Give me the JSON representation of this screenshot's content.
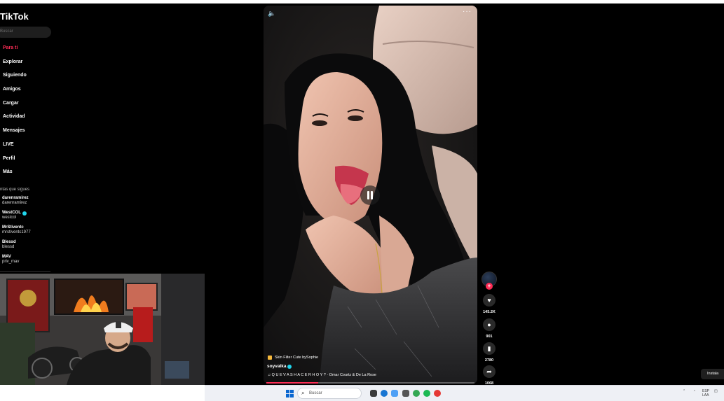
{
  "sidebar": {
    "logo": "TikTok",
    "search_placeholder": "Buscar",
    "nav": [
      {
        "label": "Para ti",
        "active": true
      },
      {
        "label": "Explorar"
      },
      {
        "label": "Siguiendo"
      },
      {
        "label": "Amigos"
      },
      {
        "label": "Cargar"
      },
      {
        "label": "Actividad"
      },
      {
        "label": "Mensajes"
      },
      {
        "label": "LIVE"
      },
      {
        "label": "Perfil"
      },
      {
        "label": "Más"
      }
    ],
    "following_title": "ntas que sigues",
    "accounts": [
      {
        "name": "darenramirez",
        "handle": "darenramirez",
        "verified": false
      },
      {
        "name": "WestCOL",
        "handle": "westcol",
        "verified": true
      },
      {
        "name": "MrStiventc",
        "handle": "mrstiventc1977",
        "verified": false
      },
      {
        "name": "Blessd",
        "handle": "blessd",
        "verified": false
      },
      {
        "name": "MAV",
        "handle": "priv_mav",
        "verified": false
      }
    ]
  },
  "video": {
    "effect_label": "Skin Filter Cute bySophie",
    "author": "soyvalka",
    "music": "♫ Q U E V A S H A C E R H O Y ?   · Omar Courtz & De La Rose",
    "progress": 0.25
  },
  "actions": {
    "likes": "145.2K",
    "comments": "901",
    "bookmarks": "2780",
    "shares": "1068"
  },
  "install_label": "Instala",
  "taskbar": {
    "search_placeholder": "Buscar",
    "lang": "ESP",
    "region": "LAA"
  },
  "colors": {
    "accent": "#fe2c55",
    "verified": "#20d5ec",
    "background": "#000000"
  }
}
